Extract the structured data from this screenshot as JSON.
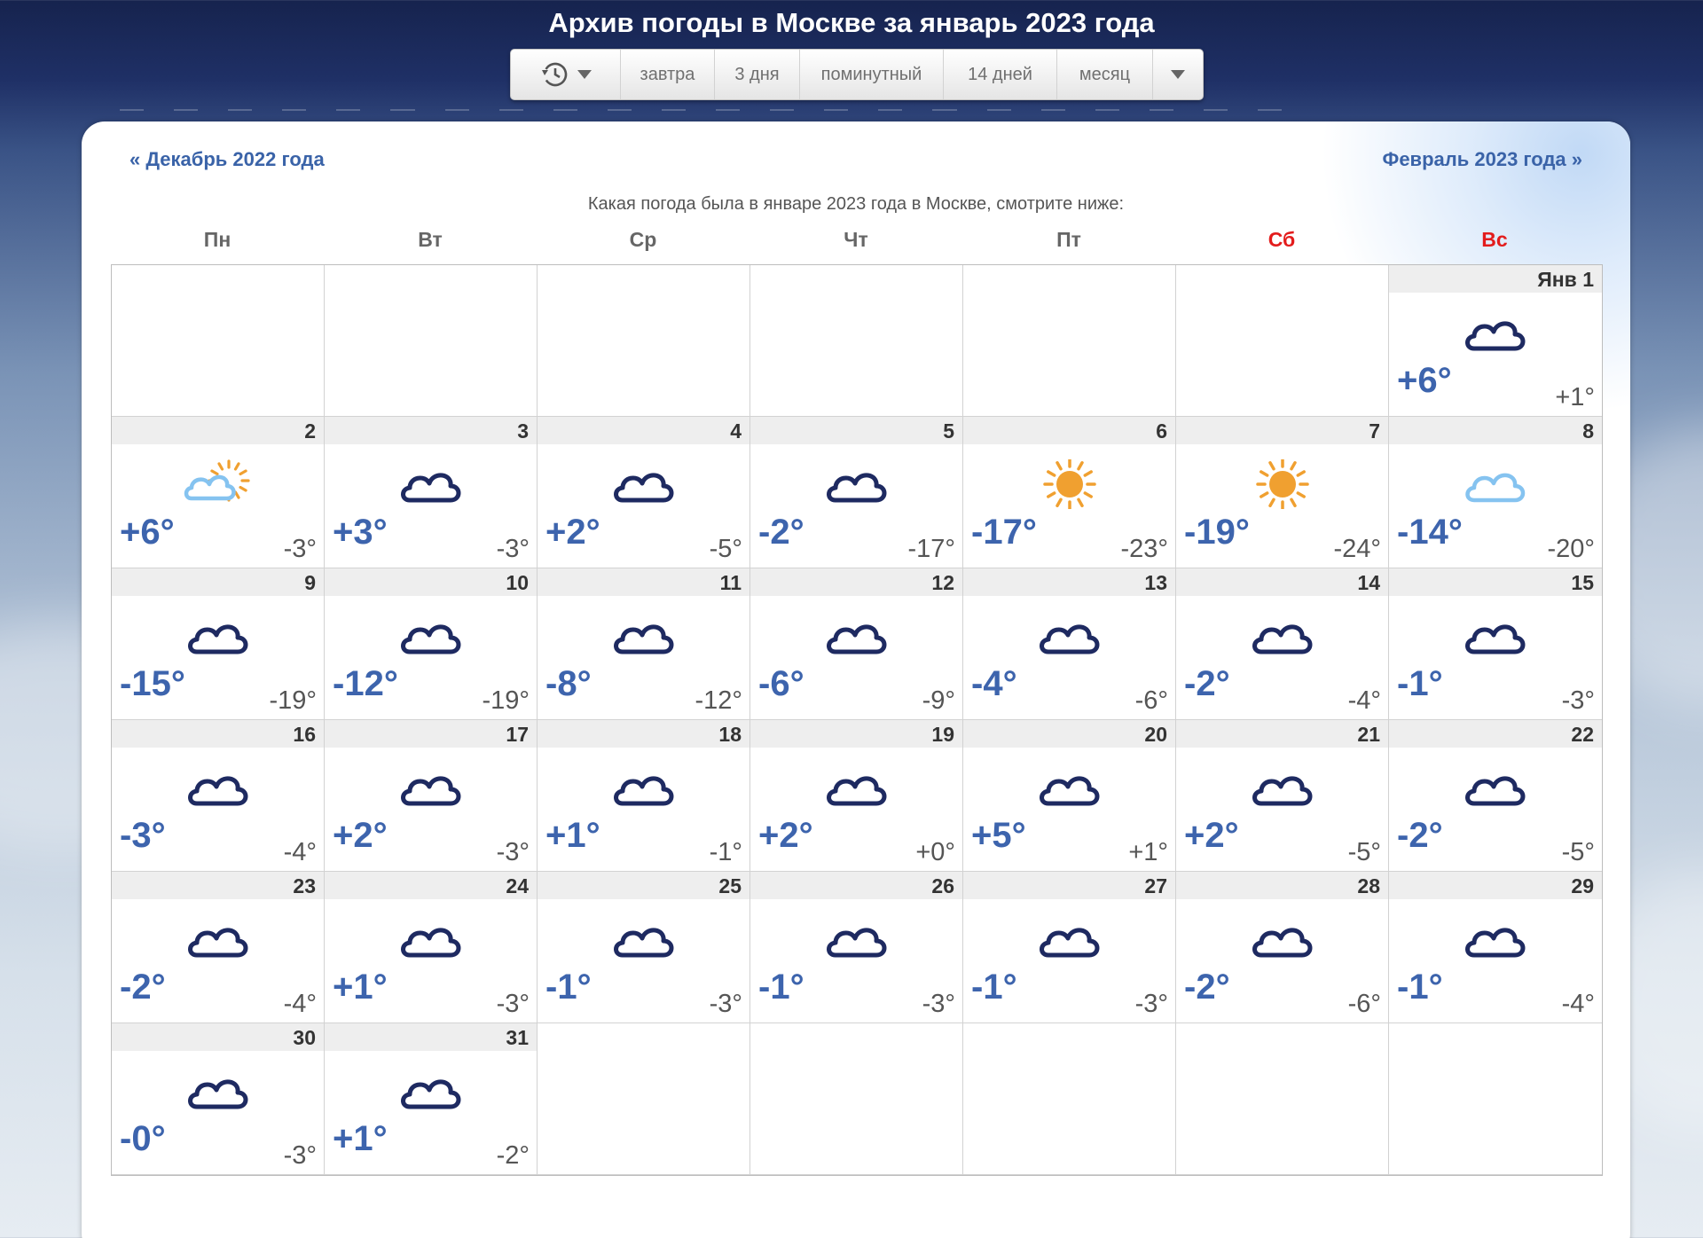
{
  "title": "Архив погоды в Москве за январь 2023 года",
  "toolbar": {
    "history_icon": "history-icon",
    "items": [
      "завтра",
      "3 дня",
      "поминутный",
      "14 дней",
      "месяц"
    ],
    "more_icon": "chevron-down-icon"
  },
  "nav": {
    "prev": "« Декабрь 2022 года",
    "next": "Февраль 2023 года »"
  },
  "subtitle": "Какая погода была в январе 2023 года в Москве, смотрите ниже:",
  "weekdays": [
    "Пн",
    "Вт",
    "Ср",
    "Чт",
    "Пт",
    "Сб",
    "Вс"
  ],
  "colors": {
    "temp_max": "#3d64ad",
    "temp_min": "#555555",
    "weekend": "#e31c1c",
    "cloud_dark": "#1e2a61",
    "cloud_light": "#85c3f0",
    "sun": "#f0a030"
  },
  "leading_empty": 6,
  "days": [
    {
      "label": "Янв  1",
      "icon": "cloudy",
      "max": "+6°",
      "min": "+1°"
    },
    {
      "label": "2",
      "icon": "partly-cloudy",
      "max": "+6°",
      "min": "-3°"
    },
    {
      "label": "3",
      "icon": "cloudy",
      "max": "+3°",
      "min": "-3°"
    },
    {
      "label": "4",
      "icon": "cloudy",
      "max": "+2°",
      "min": "-5°"
    },
    {
      "label": "5",
      "icon": "cloudy",
      "max": "-2°",
      "min": "-17°"
    },
    {
      "label": "6",
      "icon": "sunny",
      "max": "-17°",
      "min": "-23°"
    },
    {
      "label": "7",
      "icon": "sunny",
      "max": "-19°",
      "min": "-24°"
    },
    {
      "label": "8",
      "icon": "light-cloud",
      "max": "-14°",
      "min": "-20°"
    },
    {
      "label": "9",
      "icon": "cloudy",
      "max": "-15°",
      "min": "-19°"
    },
    {
      "label": "10",
      "icon": "cloudy",
      "max": "-12°",
      "min": "-19°"
    },
    {
      "label": "11",
      "icon": "cloudy",
      "max": "-8°",
      "min": "-12°"
    },
    {
      "label": "12",
      "icon": "cloudy",
      "max": "-6°",
      "min": "-9°"
    },
    {
      "label": "13",
      "icon": "cloudy",
      "max": "-4°",
      "min": "-6°"
    },
    {
      "label": "14",
      "icon": "cloudy",
      "max": "-2°",
      "min": "-4°"
    },
    {
      "label": "15",
      "icon": "cloudy",
      "max": "-1°",
      "min": "-3°"
    },
    {
      "label": "16",
      "icon": "cloudy",
      "max": "-3°",
      "min": "-4°"
    },
    {
      "label": "17",
      "icon": "cloudy",
      "max": "+2°",
      "min": "-3°"
    },
    {
      "label": "18",
      "icon": "cloudy",
      "max": "+1°",
      "min": "-1°"
    },
    {
      "label": "19",
      "icon": "cloudy",
      "max": "+2°",
      "min": "+0°"
    },
    {
      "label": "20",
      "icon": "cloudy",
      "max": "+5°",
      "min": "+1°"
    },
    {
      "label": "21",
      "icon": "cloudy",
      "max": "+2°",
      "min": "-5°"
    },
    {
      "label": "22",
      "icon": "cloudy",
      "max": "-2°",
      "min": "-5°"
    },
    {
      "label": "23",
      "icon": "cloudy",
      "max": "-2°",
      "min": "-4°"
    },
    {
      "label": "24",
      "icon": "cloudy",
      "max": "+1°",
      "min": "-3°"
    },
    {
      "label": "25",
      "icon": "cloudy",
      "max": "-1°",
      "min": "-3°"
    },
    {
      "label": "26",
      "icon": "cloudy",
      "max": "-1°",
      "min": "-3°"
    },
    {
      "label": "27",
      "icon": "cloudy",
      "max": "-1°",
      "min": "-3°"
    },
    {
      "label": "28",
      "icon": "cloudy",
      "max": "-2°",
      "min": "-6°"
    },
    {
      "label": "29",
      "icon": "cloudy",
      "max": "-1°",
      "min": "-4°"
    },
    {
      "label": "30",
      "icon": "cloudy",
      "max": "-0°",
      "min": "-3°"
    },
    {
      "label": "31",
      "icon": "cloudy",
      "max": "+1°",
      "min": "-2°"
    }
  ],
  "trailing_empty": 5
}
